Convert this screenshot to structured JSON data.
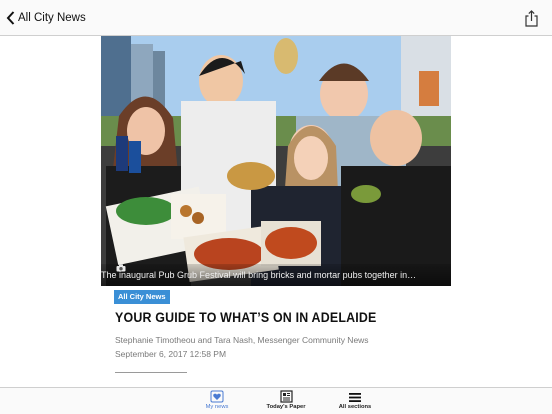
{
  "nav": {
    "back_label": "All City News"
  },
  "article": {
    "image_caption": "The inaugural Pub Grub Festival will bring bricks and mortar pubs together in…",
    "section_tag": "All City News",
    "headline": "YOUR GUIDE TO WHAT’S ON IN ADELAIDE",
    "byline": "Stephanie Timotheou and Tara Nash, Messenger Community News",
    "date": "September 6, 2017 12:58 PM"
  },
  "tabs": [
    {
      "label": "My news",
      "icon": "heart-newspaper-icon",
      "active": true
    },
    {
      "label": "Today's Paper",
      "icon": "newspaper-icon",
      "active": false
    },
    {
      "label": "All sections",
      "icon": "menu-icon",
      "active": false
    }
  ],
  "colors": {
    "accent": "#3a8fd6",
    "active_tab": "#4a7bd2"
  }
}
